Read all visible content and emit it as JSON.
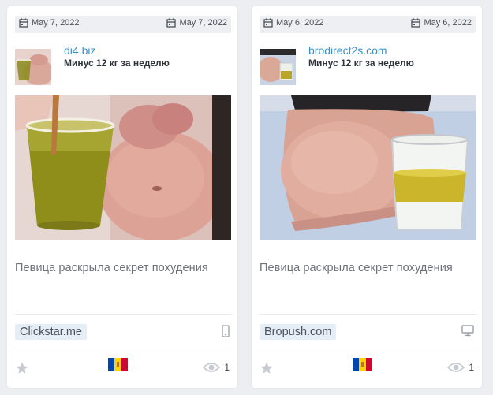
{
  "cards": [
    {
      "first_seen": "May 7, 2022",
      "last_seen": "May 7, 2022",
      "domain": "di4.biz",
      "title": "Минус 12 кг за неделю",
      "text": "Певица раскрыла секрет похудения",
      "network": "Clickstar.me",
      "device": "mobile-icon",
      "country": "Moldova",
      "flag_colors": [
        "#0046ae",
        "#ffd200",
        "#cc092f"
      ],
      "views": "1"
    },
    {
      "first_seen": "May 6, 2022",
      "last_seen": "May 6, 2022",
      "domain": "brodirect2s.com",
      "title": "Минус 12 кг за неделю",
      "text": "Певица раскрыла секрет похудения",
      "network": "Bropush.com",
      "device": "desktop-icon",
      "country": "Moldova",
      "flag_colors": [
        "#0046ae",
        "#ffd200",
        "#cc092f"
      ],
      "views": "1"
    }
  ],
  "colors": {
    "domain_link": "#3a8fc7",
    "network_badge_bg": "#e5eef7",
    "date_bar_bg": "#edeff3"
  }
}
